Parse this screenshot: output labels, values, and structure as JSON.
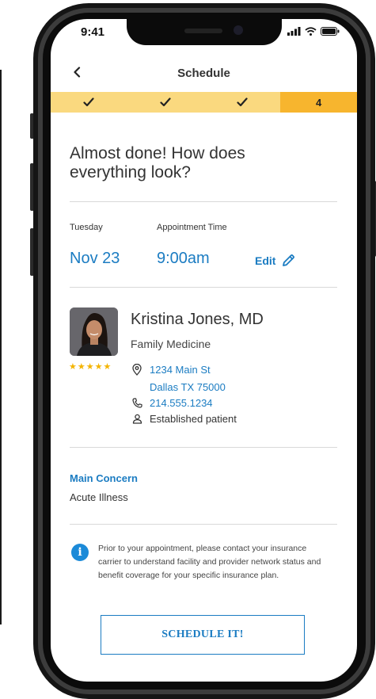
{
  "status_bar": {
    "time": "9:41"
  },
  "nav": {
    "title": "Schedule"
  },
  "progress": {
    "steps": [
      "done",
      "done",
      "done",
      "current"
    ],
    "current_label": "4"
  },
  "heading": "Almost done! How does everything look?",
  "appointment": {
    "day_label": "Tuesday",
    "date": "Nov 23",
    "time_label": "Appointment Time",
    "time": "9:00am",
    "edit_label": "Edit"
  },
  "provider": {
    "name": "Kristina Jones, MD",
    "specialty": "Family Medicine",
    "rating": 5,
    "address_line1": "1234 Main St",
    "address_line2": "Dallas TX 75000",
    "phone": "214.555.1234",
    "patient_status": "Established patient"
  },
  "concern": {
    "title": "Main Concern",
    "value": "Acute Illness"
  },
  "notice": "Prior to your appointment, please contact your insurance carrier to understand facility and provider network status and benefit coverage for your specific insurance plan.",
  "cta": {
    "label": "SCHEDULE IT!"
  },
  "colors": {
    "accent": "#1b7cc2",
    "progress_done": "#fad97f",
    "progress_current": "#f7b52e",
    "star": "#f4b400"
  }
}
